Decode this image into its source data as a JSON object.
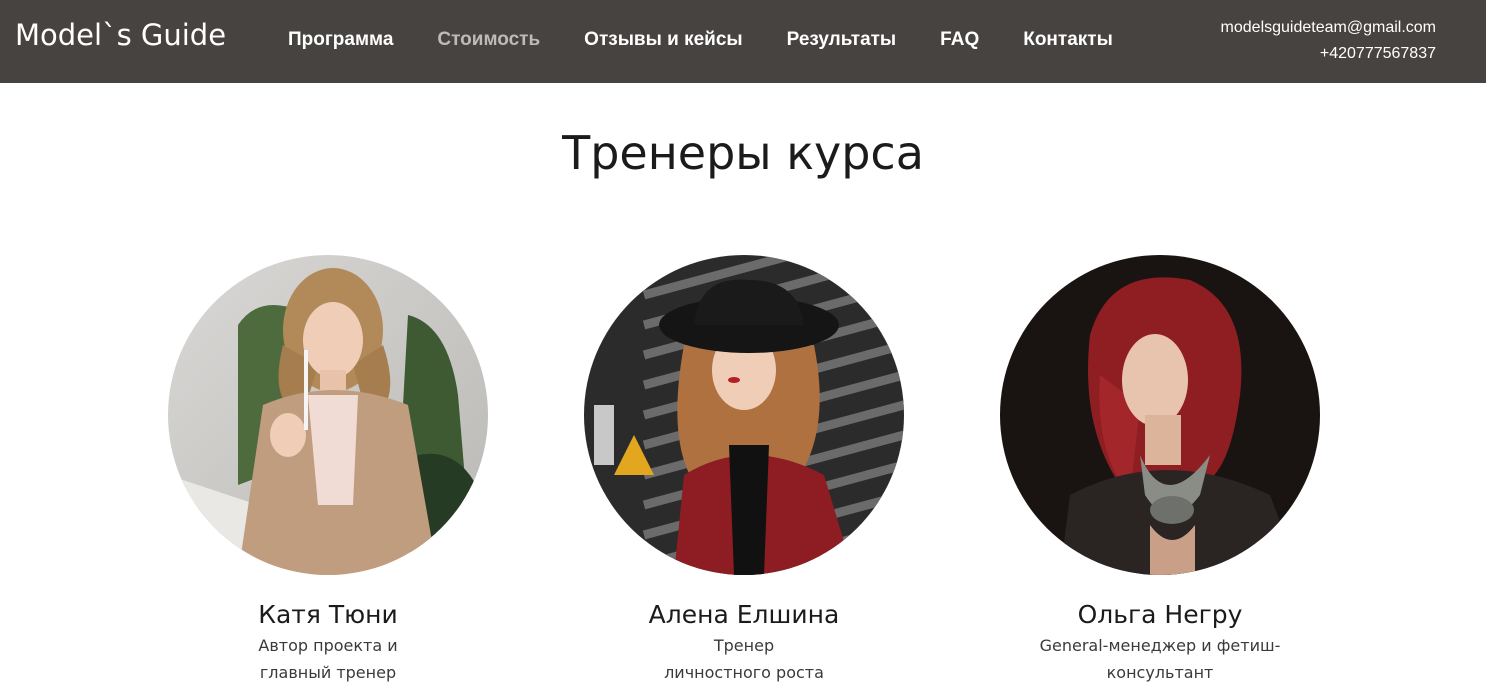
{
  "header": {
    "logo": "Model`s Guide",
    "nav": [
      {
        "label": "Программа",
        "active": false
      },
      {
        "label": "Стоимость",
        "active": true
      },
      {
        "label": "Отзывы и кейсы",
        "active": false
      },
      {
        "label": "Результаты",
        "active": false
      },
      {
        "label": "FAQ",
        "active": false
      },
      {
        "label": "Контакты",
        "active": false
      }
    ],
    "email": "modelsguideteam@gmail.com",
    "phone": "+420777567837"
  },
  "section": {
    "title": "Тренеры курса"
  },
  "trainers": [
    {
      "name": "Катя Тюни",
      "role": "Автор проекта и\nглавный тренер",
      "photo_icon": "trainer-photo-katya"
    },
    {
      "name": "Алена Елшина",
      "role": "Тренер\nличностного роста",
      "photo_icon": "trainer-photo-alena"
    },
    {
      "name": "Ольга Негру",
      "role": "General-менеджер и фетиш-\nконсультант",
      "photo_icon": "trainer-photo-olga"
    }
  ],
  "colors": {
    "header_bg": "#474341",
    "nav_active": "#bdbab8",
    "text_dark": "#1b1b1b"
  }
}
